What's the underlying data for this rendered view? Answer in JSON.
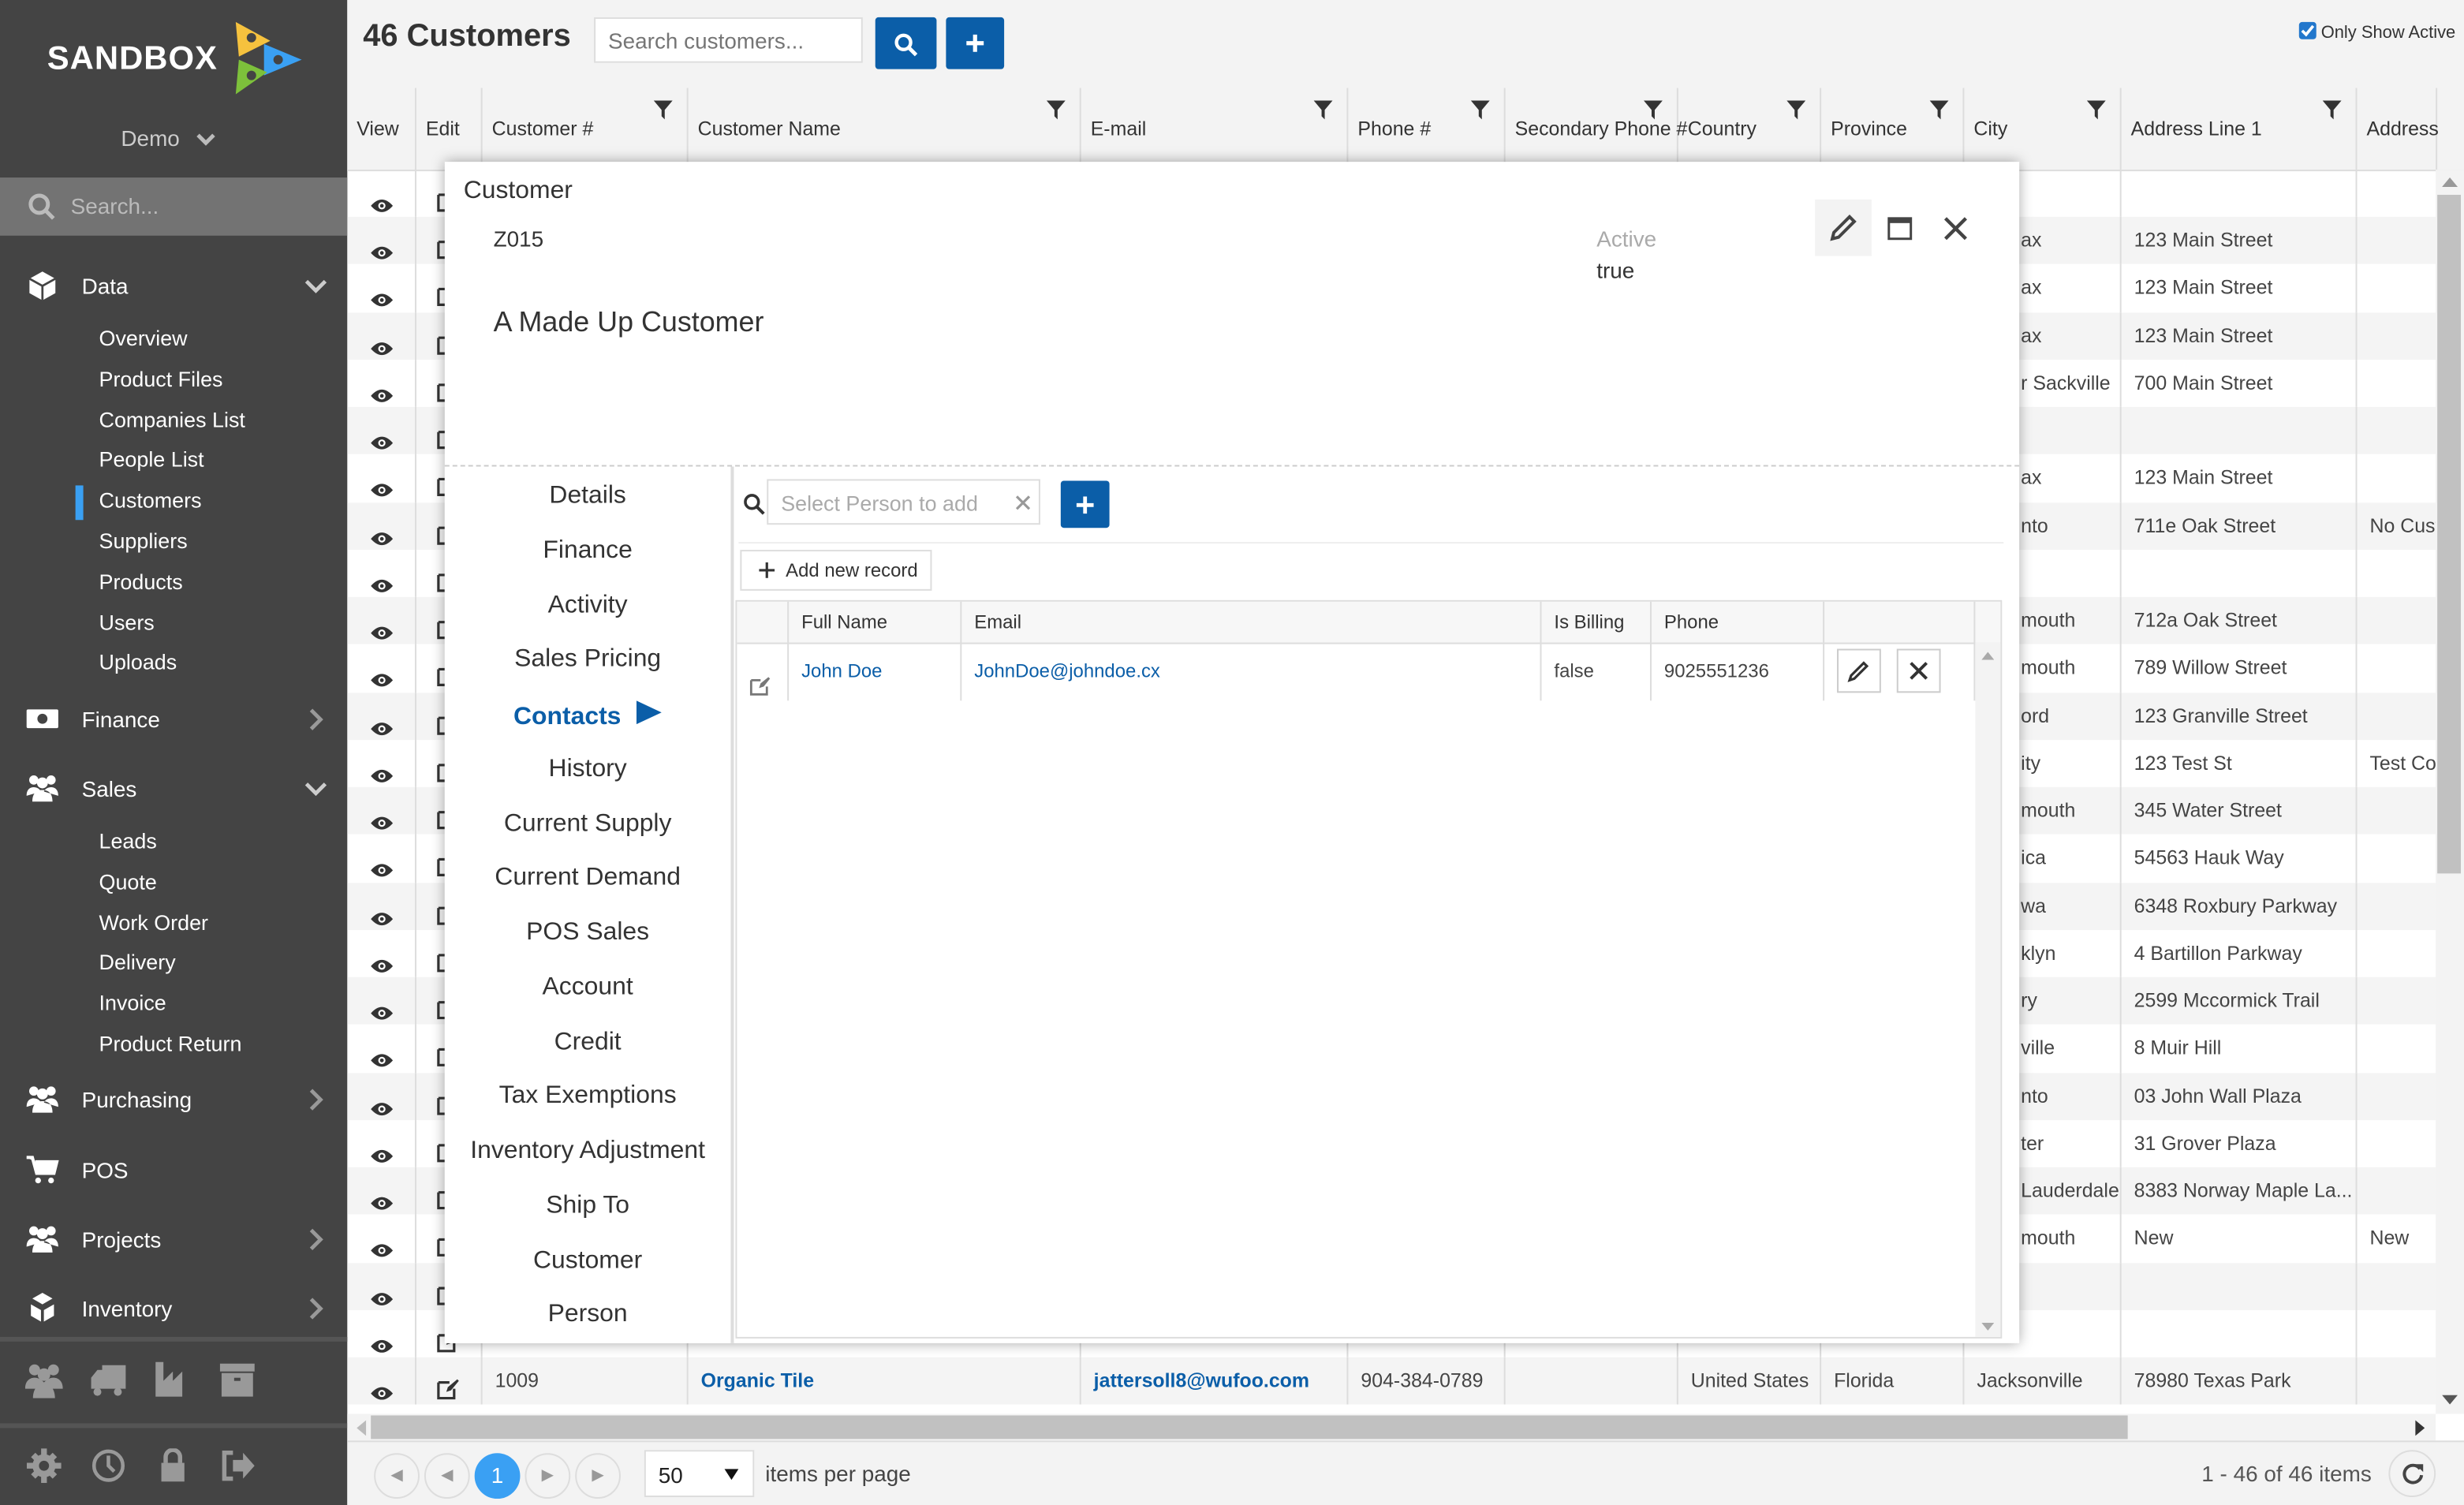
{
  "brand": {
    "logo_text": "SANDBOX",
    "tenant": "Demo",
    "search_placeholder": "Search...",
    "logo_colors": [
      "#f6c23e",
      "#3aa0f3",
      "#7dc13b"
    ]
  },
  "sidebar": {
    "sections": [
      {
        "label": "Data",
        "icon": "cube-icon",
        "expanded": true,
        "items": [
          "Overview",
          "Product Files",
          "Companies List",
          "People List",
          "Customers",
          "Suppliers",
          "Products",
          "Users",
          "Uploads"
        ]
      },
      {
        "label": "Finance",
        "icon": "money-icon",
        "expanded": false
      },
      {
        "label": "Sales",
        "icon": "users-icon",
        "expanded": true,
        "items": [
          "Leads",
          "Quote",
          "Work Order",
          "Delivery",
          "Invoice",
          "Product Return"
        ]
      },
      {
        "label": "Purchasing",
        "icon": "users-icon",
        "expanded": false
      },
      {
        "label": "POS",
        "icon": "cart-icon",
        "expanded": false
      },
      {
        "label": "Projects",
        "icon": "users-icon",
        "expanded": false
      },
      {
        "label": "Inventory",
        "icon": "boxes-icon",
        "expanded": false
      }
    ],
    "active_item": "Customers",
    "quick_icons": [
      "people-icon",
      "truck-icon",
      "factory-icon",
      "archive-icon"
    ],
    "bottom_icons": [
      "gear-icon",
      "clock-icon",
      "lock-icon",
      "sign-out-icon"
    ]
  },
  "header": {
    "count": "46",
    "title": "Customers",
    "search_placeholder": "Search customers...",
    "only_active_label": "Only Show Active",
    "only_active_checked": true,
    "accent": "#0b5ea8"
  },
  "grid": {
    "columns": [
      "View",
      "Edit",
      "Customer #",
      "Customer Name",
      "E-mail",
      "Phone #",
      "Secondary Phone #",
      "Country",
      "Province",
      "City",
      "Address Line 1",
      "Address"
    ],
    "rows": [
      {
        "city": "",
        "addr1": "",
        "addr2": ""
      },
      {
        "city": "ax",
        "addr1": "123 Main Street",
        "addr2": ""
      },
      {
        "city": "ax",
        "addr1": "123 Main Street",
        "addr2": ""
      },
      {
        "city": "ax",
        "addr1": "123 Main Street",
        "addr2": ""
      },
      {
        "city": "r Sackville",
        "addr1": "700 Main Street",
        "addr2": ""
      },
      {
        "city": "",
        "addr1": "",
        "addr2": ""
      },
      {
        "city": "ax",
        "addr1": "123 Main Street",
        "addr2": ""
      },
      {
        "city": "nto",
        "addr1": "711e Oak Street",
        "addr2": "No Cust"
      },
      {
        "city": "",
        "addr1": "",
        "addr2": ""
      },
      {
        "city": "mouth",
        "addr1": "712a Oak Street",
        "addr2": ""
      },
      {
        "city": "mouth",
        "addr1": "789 Willow Street",
        "addr2": ""
      },
      {
        "city": "ord",
        "addr1": "123 Granville Street",
        "addr2": ""
      },
      {
        "city": "ity",
        "addr1": "123 Test St",
        "addr2": "Test Co"
      },
      {
        "city": "mouth",
        "addr1": "345 Water Street",
        "addr2": ""
      },
      {
        "city": "ica",
        "addr1": "54563 Hauk Way",
        "addr2": ""
      },
      {
        "city": "wa",
        "addr1": "6348 Roxbury Parkway",
        "addr2": ""
      },
      {
        "city": "klyn",
        "addr1": "4 Bartillon Parkway",
        "addr2": ""
      },
      {
        "city": "ry",
        "addr1": "2599 Mccormick Trail",
        "addr2": ""
      },
      {
        "city": "ville",
        "addr1": "8 Muir Hill",
        "addr2": ""
      },
      {
        "city": "nto",
        "addr1": "03 John Wall Plaza",
        "addr2": ""
      },
      {
        "city": "ter",
        "addr1": "31 Grover Plaza",
        "addr2": ""
      },
      {
        "city": "Lauderdale",
        "addr1": "8383 Norway Maple La...",
        "addr2": ""
      },
      {
        "city": "mouth",
        "addr1": "New",
        "addr2": "New"
      },
      {
        "city": "",
        "addr1": "",
        "addr2": ""
      },
      {
        "city": "",
        "addr1": "",
        "addr2": ""
      },
      {
        "num": "1009",
        "name": "Organic Tile",
        "email": "jattersoll8@wufoo.com",
        "phone": "904-384-0789",
        "phone2": "",
        "country": "United States",
        "province": "Florida",
        "city": "Jacksonville",
        "addr1": "78980 Texas Park",
        "addr2": "",
        "full": true
      }
    ]
  },
  "pager": {
    "current_page": "1",
    "page_size": "50",
    "page_size_label": "items per page",
    "summary": "1 - 46 of 46 items"
  },
  "modal": {
    "heading": "Customer",
    "code": "Z015",
    "name": "A Made Up Customer",
    "active_label": "Active",
    "active_value": "true",
    "tabs": [
      "Details",
      "Finance",
      "Activity",
      "Sales Pricing",
      "Contacts",
      "History",
      "Current Supply",
      "Current Demand",
      "POS Sales",
      "Account",
      "Credit",
      "Tax Exemptions",
      "Inventory Adjustment",
      "Ship To",
      "Customer",
      "Person"
    ],
    "active_tab": "Contacts",
    "contacts": {
      "select_placeholder": "Select Person to add",
      "add_new_label": "Add new record",
      "columns": [
        "Full Name",
        "Email",
        "Is Billing",
        "Phone"
      ],
      "rows": [
        {
          "full_name": "John Doe",
          "email": "JohnDoe@johndoe.cx",
          "is_billing": "false",
          "phone": "9025551236"
        }
      ]
    }
  }
}
